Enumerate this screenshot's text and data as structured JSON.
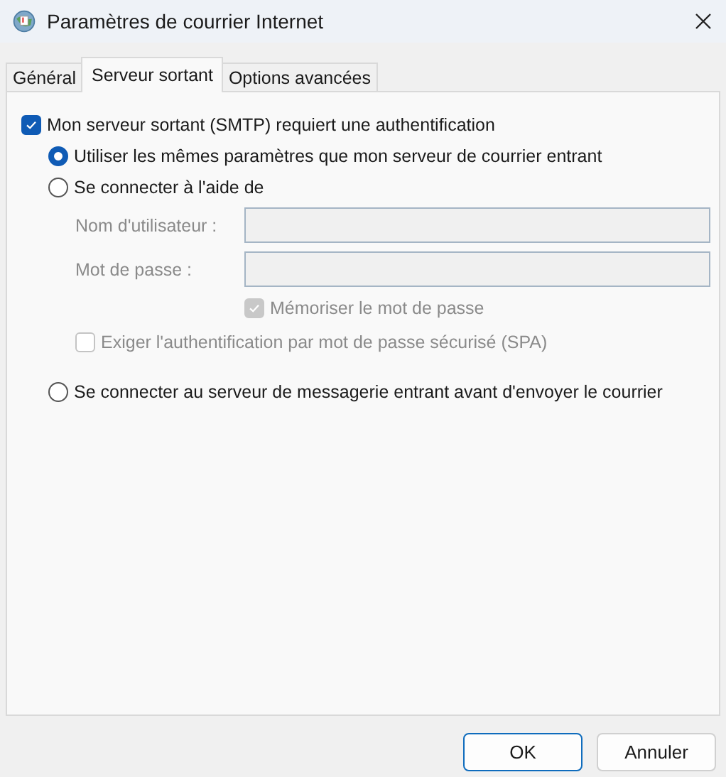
{
  "window": {
    "title": "Paramètres de courrier Internet"
  },
  "tabs": [
    {
      "label": "Général",
      "selected": false
    },
    {
      "label": "Serveur sortant",
      "selected": true
    },
    {
      "label": "Options avancées",
      "selected": false
    }
  ],
  "smtp_auth": {
    "label": "Mon serveur sortant (SMTP) requiert une authentification",
    "checked": true
  },
  "options": [
    {
      "label": "Utiliser les mêmes paramètres que mon serveur de courrier entrant",
      "selected": true
    },
    {
      "label": "Se connecter à l'aide de",
      "selected": false,
      "fields": [
        {
          "label": "Nom d'utilisateur :",
          "disabled": true
        },
        {
          "label": "Mot de passe :",
          "disabled": true
        }
      ],
      "checkboxes": [
        {
          "kind": "field-aligned",
          "label": "Mémoriser le mot de passe",
          "checked": true,
          "disabled": true
        },
        {
          "kind": "plain",
          "label": "Exiger l'authentification par mot de passe sécurisé (SPA)",
          "checked": false,
          "disabled": true
        }
      ]
    },
    {
      "label": "Se connecter au serveur de messagerie entrant avant d'envoyer le courrier",
      "selected": false
    }
  ],
  "buttons": [
    {
      "label": "OK",
      "default": true
    },
    {
      "label": "Annuler",
      "default": false
    }
  ]
}
